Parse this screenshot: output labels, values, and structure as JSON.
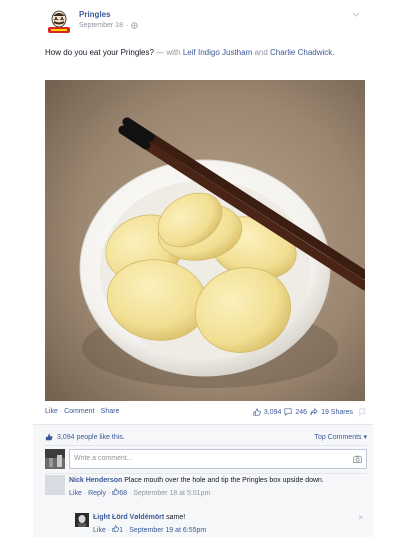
{
  "post": {
    "page_name": "Pringles",
    "date": "September 18",
    "text_main": "How do you eat your Pringles?",
    "text_with": " — with ",
    "tag1": "Leif Indigo Justham",
    "text_and": " and ",
    "tag2": "Charlie Chadwick",
    "text_end": "."
  },
  "actions": {
    "like": "Like",
    "comment": "Comment",
    "share": "Share",
    "dot": " · ",
    "likes_count": "3,094",
    "comments_count": "246",
    "shares": "19 Shares"
  },
  "ufi": {
    "likes_text": "3,094 people like this.",
    "top_comments": "Top Comments",
    "top_comments_arrow": "▾",
    "composer_placeholder": "Write a comment..."
  },
  "comments": [
    {
      "name": "Nick Henderson",
      "text": " Place mouth over the hole and tip the Pringles box upside down.",
      "like": "Like",
      "reply": "Reply",
      "likes": "68",
      "time": "September 18 at 5:01pm"
    }
  ],
  "reply": {
    "name": "Łight Łörd Vøldémört",
    "text": " same!",
    "like": "Like",
    "likes": "1",
    "time": "September 19 at 6:55pm",
    "close": "×"
  },
  "colors": {
    "link": "#3b5998",
    "muted": "#90949c"
  }
}
